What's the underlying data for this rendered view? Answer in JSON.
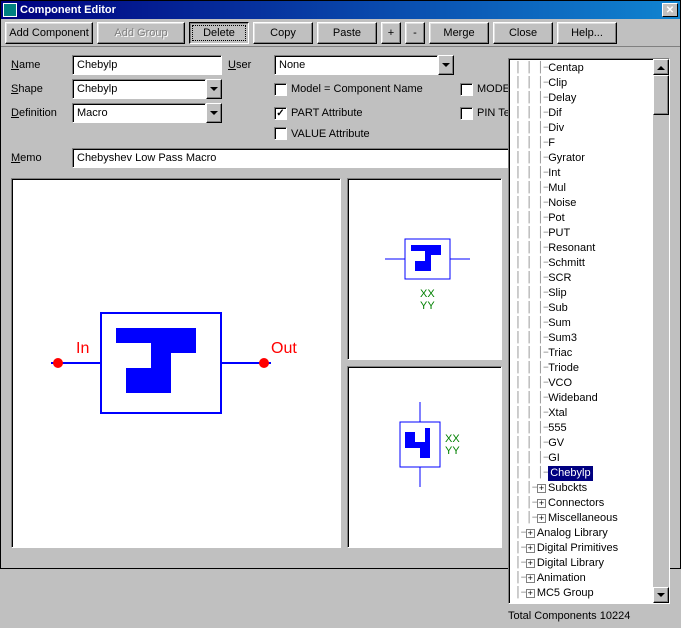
{
  "window": {
    "title": "Component Editor"
  },
  "toolbar": {
    "add_component": "Add Component",
    "add_group": "Add Group",
    "delete": "Delete",
    "copy": "Copy",
    "paste": "Paste",
    "plus": "+",
    "minus": "-",
    "merge": "Merge",
    "close": "Close",
    "help": "Help..."
  },
  "form": {
    "name_label": "Name",
    "name_value": "Chebylp",
    "user_label": "User",
    "user_value": "None",
    "shape_label": "Shape",
    "shape_value": "Chebylp",
    "definition_label": "Definition",
    "definition_value": "Macro",
    "model_comp_name": "Model = Component Name",
    "model_attr": "MODEL Attribute",
    "part_attr": "PART Attribute",
    "pin_text": "PIN Text",
    "value_attr": "VALUE Attribute",
    "memo_label": "Memo",
    "memo_value": "Chebyshev Low Pass Macro"
  },
  "checks": {
    "model_comp_name": false,
    "model_attr": false,
    "part_attr": true,
    "pin_text": false,
    "value_attr": false
  },
  "preview": {
    "in": "In",
    "out": "Out",
    "xx": "XX",
    "yy": "YY"
  },
  "tree": {
    "items": [
      {
        "label": "Centap",
        "depth": 3,
        "leaf": true
      },
      {
        "label": "Clip",
        "depth": 3,
        "leaf": true
      },
      {
        "label": "Delay",
        "depth": 3,
        "leaf": true
      },
      {
        "label": "Dif",
        "depth": 3,
        "leaf": true
      },
      {
        "label": "Div",
        "depth": 3,
        "leaf": true
      },
      {
        "label": "F",
        "depth": 3,
        "leaf": true
      },
      {
        "label": "Gyrator",
        "depth": 3,
        "leaf": true
      },
      {
        "label": "Int",
        "depth": 3,
        "leaf": true
      },
      {
        "label": "Mul",
        "depth": 3,
        "leaf": true
      },
      {
        "label": "Noise",
        "depth": 3,
        "leaf": true
      },
      {
        "label": "Pot",
        "depth": 3,
        "leaf": true
      },
      {
        "label": "PUT",
        "depth": 3,
        "leaf": true
      },
      {
        "label": "Resonant",
        "depth": 3,
        "leaf": true
      },
      {
        "label": "Schmitt",
        "depth": 3,
        "leaf": true
      },
      {
        "label": "SCR",
        "depth": 3,
        "leaf": true
      },
      {
        "label": "Slip",
        "depth": 3,
        "leaf": true
      },
      {
        "label": "Sub",
        "depth": 3,
        "leaf": true
      },
      {
        "label": "Sum",
        "depth": 3,
        "leaf": true
      },
      {
        "label": "Sum3",
        "depth": 3,
        "leaf": true
      },
      {
        "label": "Triac",
        "depth": 3,
        "leaf": true
      },
      {
        "label": "Triode",
        "depth": 3,
        "leaf": true
      },
      {
        "label": "VCO",
        "depth": 3,
        "leaf": true
      },
      {
        "label": "Wideband",
        "depth": 3,
        "leaf": true
      },
      {
        "label": "Xtal",
        "depth": 3,
        "leaf": true
      },
      {
        "label": "555",
        "depth": 3,
        "leaf": true
      },
      {
        "label": "GV",
        "depth": 3,
        "leaf": true
      },
      {
        "label": "GI",
        "depth": 3,
        "leaf": true
      },
      {
        "label": "Chebylp",
        "depth": 3,
        "leaf": true,
        "selected": true
      },
      {
        "label": "Subckts",
        "depth": 2,
        "leaf": false
      },
      {
        "label": "Connectors",
        "depth": 2,
        "leaf": false
      },
      {
        "label": "Miscellaneous",
        "depth": 2,
        "leaf": false
      },
      {
        "label": "Analog Library",
        "depth": 1,
        "leaf": false
      },
      {
        "label": "Digital Primitives",
        "depth": 1,
        "leaf": false
      },
      {
        "label": "Digital Library",
        "depth": 1,
        "leaf": false
      },
      {
        "label": "Animation",
        "depth": 1,
        "leaf": false
      },
      {
        "label": "MC5 Group",
        "depth": 1,
        "leaf": false
      }
    ]
  },
  "status": {
    "total_label": "Total Components",
    "total_value": "10224"
  }
}
